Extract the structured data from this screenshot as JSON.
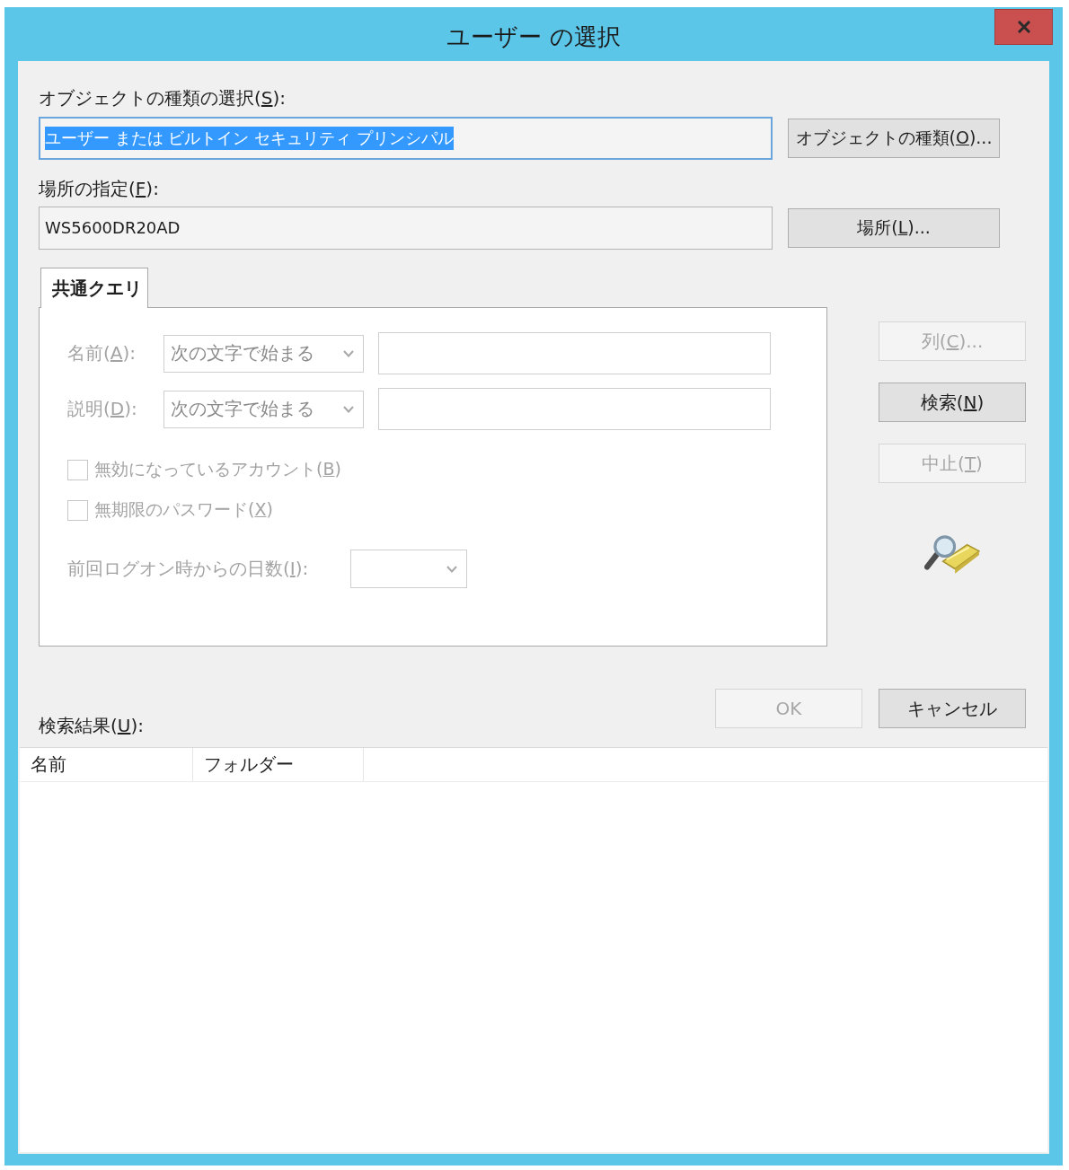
{
  "window": {
    "title": "ユーザー の選択"
  },
  "object_type": {
    "label": "オブジェクトの種類の選択(S):",
    "value": "ユーザー または ビルトイン セキュリティ プリンシパル",
    "highlighted": true,
    "focused": true,
    "button": {
      "label": "オブジェクトの種類(O)..."
    }
  },
  "location": {
    "label": "場所の指定(F):",
    "value": "WS5600DR20AD",
    "highlighted": false,
    "focused": false,
    "button": {
      "label": "場所(L)..."
    }
  },
  "tabs": [
    {
      "label": "共通クエリ",
      "selected": true
    }
  ],
  "query": {
    "fields": [
      {
        "kind": "combo_text",
        "label": "名前(A):",
        "value": "次の文字で始まる",
        "disabled": true
      },
      {
        "kind": "combo_text",
        "label": "説明(D):",
        "value": "次の文字で始まる",
        "disabled": true
      },
      {
        "kind": "checkbox",
        "label": "無効になっているアカウント(B)",
        "checked": false,
        "disabled": true
      },
      {
        "kind": "checkbox",
        "label": "無期限のパスワード(X)",
        "checked": false,
        "disabled": true
      },
      {
        "kind": "combo",
        "label": "前回ログオン時からの日数(I):",
        "disabled": true
      }
    ]
  },
  "side_buttons": [
    {
      "label": "列(C)...",
      "disabled": true
    },
    {
      "label": "検索(N)",
      "disabled": false
    },
    {
      "label": "中止(T)",
      "disabled": true
    }
  ],
  "dialog_buttons": [
    {
      "label": "OK",
      "disabled": true
    },
    {
      "label": "キャンセル",
      "disabled": false
    }
  ],
  "results": {
    "label": "検索結果(U):",
    "columns": [
      "名前",
      "フォルダー"
    ]
  }
}
